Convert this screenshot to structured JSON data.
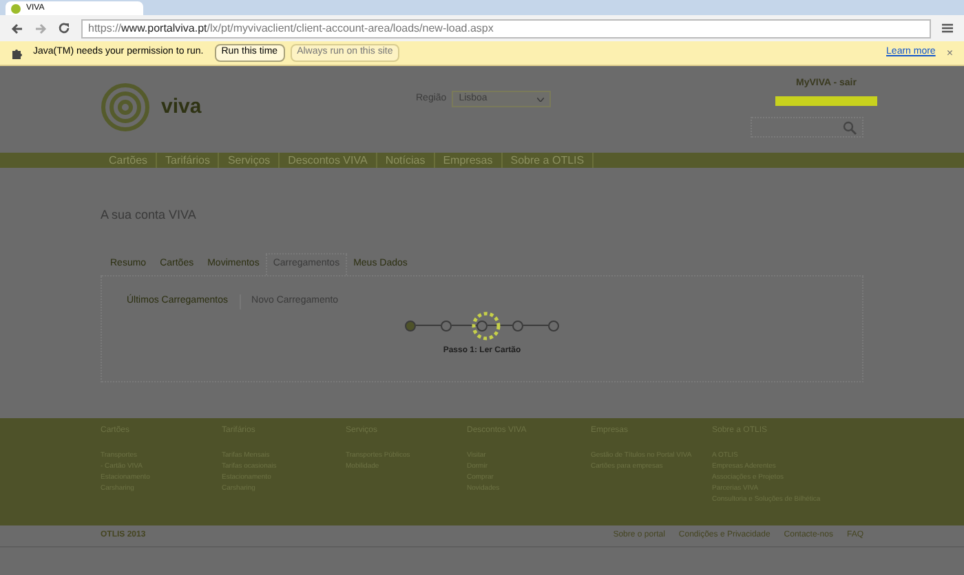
{
  "browser": {
    "tab_title": "VIVA",
    "url_prefix": "https://",
    "url_host": "www.portalviva.pt",
    "url_path": "/lx/pt/myvivaclient/client-account-area/loads/new-load.aspx"
  },
  "infobar": {
    "message": "Java(TM) needs your permission to run.",
    "buttons": [
      "Run this time",
      "Always run on this site"
    ],
    "link": "Learn more",
    "close": "×"
  },
  "header": {
    "logo_text": "viva",
    "region_label": "Região",
    "region_value": "Lisboa",
    "account_link": "MyVIVA - sair"
  },
  "nav": [
    "Cartões",
    "Tarifários",
    "Serviços",
    "Descontos VIVA",
    "Notícias",
    "Empresas",
    "Sobre a OTLIS"
  ],
  "page_title": "A sua conta VIVA",
  "tabs": [
    {
      "label": "Resumo",
      "selected": false
    },
    {
      "label": "Cartões",
      "selected": false
    },
    {
      "label": "Movimentos",
      "selected": false
    },
    {
      "label": "Carregamentos",
      "selected": true
    },
    {
      "label": "Meus Dados",
      "selected": false
    }
  ],
  "subtabs": [
    {
      "label": "Últimos Carregamentos",
      "selected": false
    },
    {
      "label": "Novo Carregamento",
      "selected": true
    }
  ],
  "steps": [
    {
      "done": true
    },
    {
      "done": false
    },
    {
      "done": false
    },
    {
      "done": false
    },
    {
      "done": false
    }
  ],
  "step_label": "Passo 1: Ler Cartão",
  "footer_columns": [
    {
      "title": "Cartões",
      "links": [
        "Transportes",
        "- Cartão VIVA",
        "Estacionamento",
        "Carsharing"
      ]
    },
    {
      "title": "Tarifários",
      "links": [
        "Tarifas Mensais",
        "Tarifas ocasionais",
        "Estacionamento",
        "Carsharing"
      ]
    },
    {
      "title": "Serviços",
      "links": [
        "Transportes Públicos",
        "Mobilidade"
      ]
    },
    {
      "title": "Descontos VIVA",
      "links": [
        "Visitar",
        "Dormir",
        "Comprar",
        "Novidades"
      ]
    },
    {
      "title": "Empresas",
      "links": [
        "Gestão de Títulos no Portal VIVA",
        "Cartões para empresas"
      ]
    },
    {
      "title": "Sobre a OTLIS",
      "links": [
        "A OTLIS",
        "Empresas Aderentes",
        "Associações e Projetos",
        "Parcerias VIVA",
        "Consultoria e Soluções de Bilhética"
      ]
    }
  ],
  "bottom": {
    "copyright": "OTLIS 2013",
    "links": [
      "Sobre o portal",
      "Condições e Privacidade",
      "Contacte-nos",
      "FAQ"
    ]
  }
}
